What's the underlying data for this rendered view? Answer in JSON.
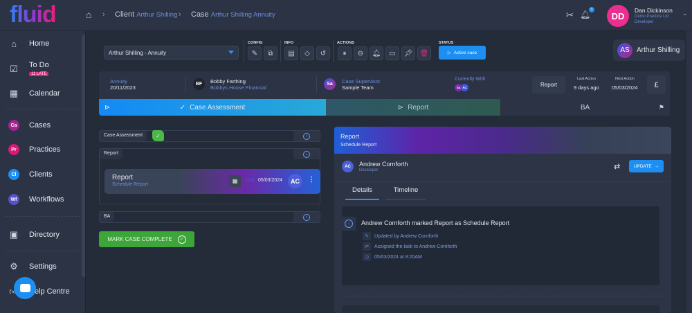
{
  "header": {
    "logo": "fluid",
    "breadcrumb": [
      {
        "label": "Client",
        "value": "Arthur Shilling"
      },
      {
        "label": "Case",
        "value": "Arthur Shilling Annuity"
      }
    ],
    "notification_count": "0",
    "user": {
      "initials": "DD",
      "name": "Dan Dickinson",
      "company": "Demo Practice Ltd",
      "role": "Developer"
    }
  },
  "sidebar": {
    "items": [
      {
        "label": "Home",
        "icon": "home-icon"
      },
      {
        "label": "To Do",
        "badge": "11 LATE",
        "icon": "checkbox-icon"
      },
      {
        "label": "Calendar",
        "icon": "calendar-icon"
      },
      {
        "label": "Cases",
        "abbr": "Ca",
        "color": "#a3238f"
      },
      {
        "label": "Practices",
        "abbr": "Pr",
        "color": "#d8197a"
      },
      {
        "label": "Clients",
        "abbr": "Cl",
        "color": "#1d8ff2"
      },
      {
        "label": "Workflows",
        "abbr": "Wf",
        "color": "#5a4fc8"
      },
      {
        "label": "Directory",
        "icon": "contact-icon"
      },
      {
        "label": "Settings",
        "icon": "gear-icon"
      },
      {
        "label": "Help Centre",
        "icon": "help-icon"
      }
    ]
  },
  "toolbar": {
    "case_select": "Arthur Shilling - Annuity",
    "groups": {
      "config": "CONFIG",
      "info": "INFO",
      "actions": "ACTIONS",
      "status": "STATUS"
    },
    "status_button": "Active case",
    "client": {
      "initials": "AS",
      "name": "Arthur Shilling"
    }
  },
  "infobar": {
    "type": "Annuity",
    "date": "20/11/2023",
    "adviser": {
      "initials": "BF",
      "name": "Bobby Farthing",
      "company": "Bobbys House Financial"
    },
    "supervisor": {
      "initials": "Sa",
      "label": "Case Supervisor",
      "team": "Sample Team"
    },
    "currently_with": {
      "label": "Currently With",
      "avatars": [
        "Sa",
        "AC"
      ]
    },
    "stage_button": "Report",
    "last_action": {
      "label": "Last Action",
      "value": "9 days ago"
    },
    "next_action": {
      "label": "Next Action",
      "value": "05/03/2024"
    },
    "currency": "£"
  },
  "stages": [
    {
      "label": "Case Assessment",
      "state": "complete"
    },
    {
      "label": "Report",
      "state": "active"
    },
    {
      "label": "BA",
      "state": "pending"
    }
  ],
  "left": {
    "sections": [
      "Case Assessment",
      "Report",
      "BA"
    ],
    "card": {
      "title": "Report",
      "subtitle": "Schedule Report",
      "due_label": "DUE:",
      "due": "05/03/2024",
      "assignee": "AC"
    },
    "complete_button": "MARK CASE COMPLETE"
  },
  "panel": {
    "title": "Report",
    "subtitle": "Schedule Report",
    "person": {
      "initials": "AC",
      "name": "Andrew Cornforth",
      "role": "Developer"
    },
    "update_button": "UPDATE",
    "tabs": [
      "Details",
      "Timeline"
    ],
    "activity": {
      "headline": "Andrew Cornforth marked Report as Schedule Report",
      "lines": [
        "Updated by Andrew Cornforth",
        "Assigned the task to Andrew Cornforth",
        "05/03/2024 at 8:20AM"
      ]
    }
  }
}
